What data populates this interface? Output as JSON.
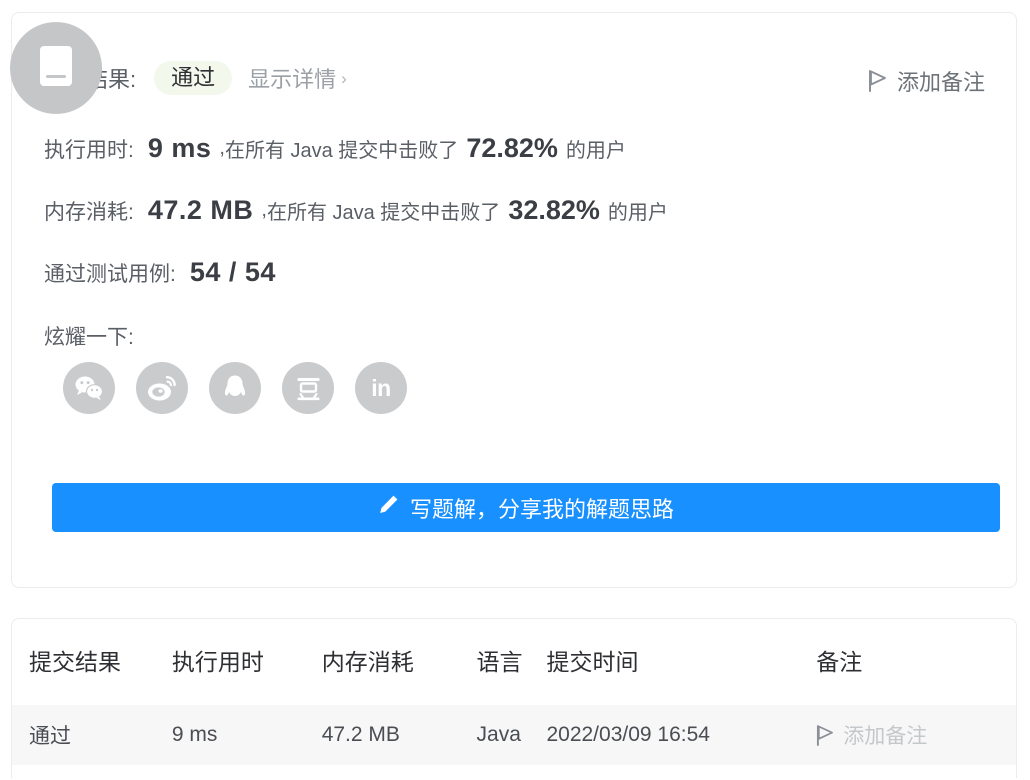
{
  "result_card": {
    "header": {
      "label": "执行结果:",
      "status": "通过",
      "detail_link": "显示详情",
      "chevron": "›",
      "add_note": "添加备注",
      "flag_icon": "flag-icon",
      "overlay_icon": "document-icon"
    },
    "runtime": {
      "label": "执行用时:",
      "value": "9 ms",
      "comma": ",",
      "mid": "在所有 Java 提交中击败了",
      "percent": "72.82%",
      "suffix": "的用户"
    },
    "memory": {
      "label": "内存消耗:",
      "value": "47.2 MB",
      "comma": ",",
      "mid": "在所有 Java 提交中击败了",
      "percent": "32.82%",
      "suffix": "的用户"
    },
    "testcases": {
      "label": "通过测试用例:",
      "value": "54 / 54"
    },
    "flaunt": {
      "label": "炫耀一下:",
      "socials": [
        {
          "name": "wechat-share-icon",
          "glyph": ""
        },
        {
          "name": "weibo-share-icon",
          "glyph": ""
        },
        {
          "name": "qq-share-icon",
          "glyph": ""
        },
        {
          "name": "douban-share-icon",
          "glyph": "豆"
        },
        {
          "name": "linkedin-share-icon",
          "glyph": "in"
        }
      ]
    },
    "write_button": {
      "label": "写题解，分享我的解题思路",
      "icon": "pencil-icon",
      "color": "#1890ff"
    }
  },
  "submissions": {
    "columns": [
      "提交结果",
      "执行用时",
      "内存消耗",
      "语言",
      "提交时间",
      "备注"
    ],
    "rows": [
      {
        "result": "通过",
        "runtime": "9 ms",
        "memory": "47.2 MB",
        "language": "Java",
        "submitted_at": "2022/03/09 16:54",
        "note": "添加备注"
      }
    ]
  },
  "colors": {
    "accent_blue": "#1890ff",
    "pass_green": "#5cb85c",
    "badge_bg": "#f3f8ec",
    "muted": "#9aa0a6"
  }
}
